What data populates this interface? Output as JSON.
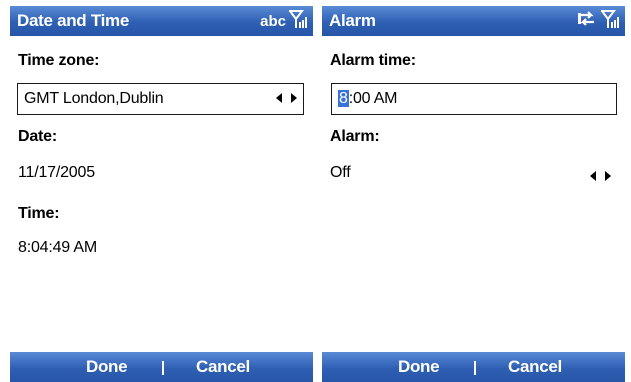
{
  "left_screen": {
    "title": "Date and Time",
    "indicator_text": "abc",
    "indicator_icons": [
      "signal-strength-icon"
    ],
    "time_zone": {
      "label": "Time zone:",
      "value": "GMT London,Dublin"
    },
    "date": {
      "label": "Date:",
      "value": "11/17/2005"
    },
    "time": {
      "label": "Time:",
      "value": "8:04:49 AM"
    },
    "softkeys": {
      "left": "Done",
      "right": "Cancel"
    }
  },
  "right_screen": {
    "title": "Alarm",
    "indicator_icons": [
      "sync-icon",
      "signal-strength-icon"
    ],
    "alarm_time": {
      "label": "Alarm time:",
      "value_highlighted": "8",
      "value_rest": ":00 AM"
    },
    "alarm": {
      "label": "Alarm:",
      "value": "Off"
    },
    "softkeys": {
      "left": "Done",
      "right": "Cancel"
    }
  },
  "colors": {
    "title_bar": "#2e5fb3",
    "selection": "#3a73d8"
  }
}
